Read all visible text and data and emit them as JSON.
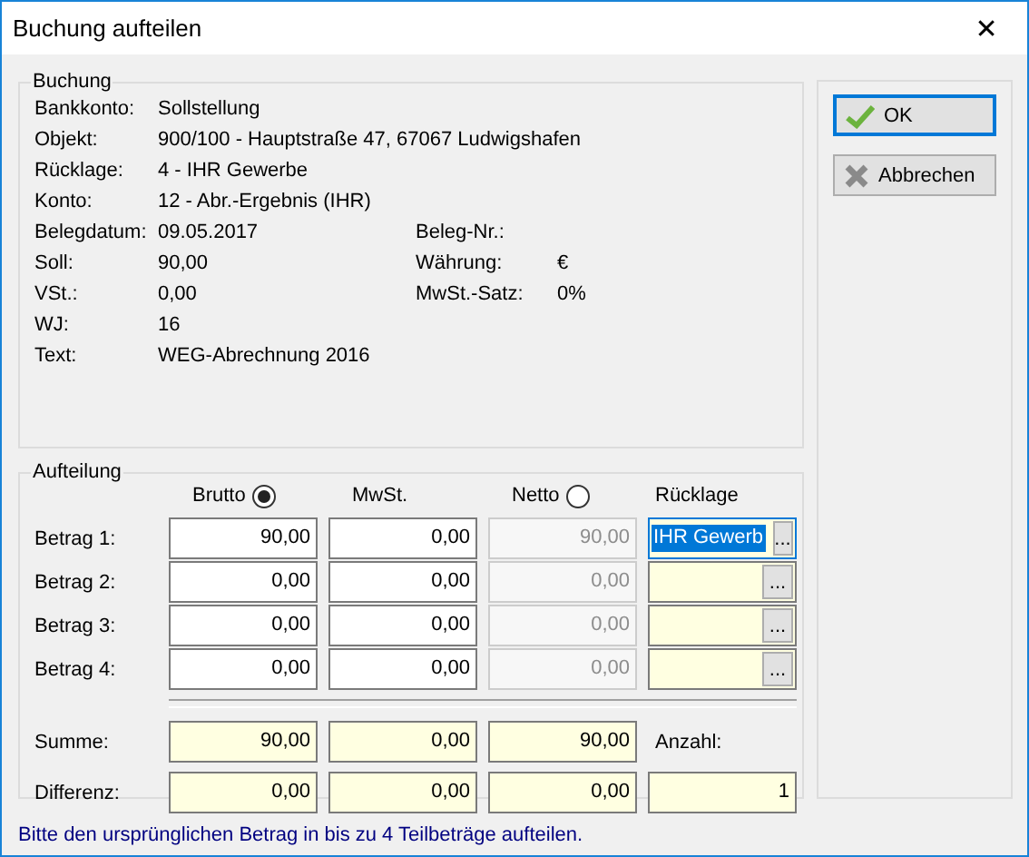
{
  "window": {
    "title": "Buchung aufteilen",
    "close": "✕"
  },
  "booking": {
    "title": "Buchung",
    "rows": [
      {
        "label": "Bankkonto:",
        "value": "Sollstellung"
      },
      {
        "label": "Objekt:",
        "value": "900/100 - Hauptstraße 47, 67067 Ludwigshafen"
      },
      {
        "label": "Rücklage:",
        "value": "4 - IHR Gewerbe"
      },
      {
        "label": "Konto:",
        "value": "12 - Abr.-Ergebnis (IHR)"
      },
      {
        "label": "Belegdatum:",
        "value": "09.05.2017",
        "label2": "Beleg-Nr.:"
      },
      {
        "label": "Soll:",
        "value": "90,00",
        "label2": "Währung:",
        "value2": "€"
      },
      {
        "label": "VSt.:",
        "value": "0,00",
        "label2": "MwSt.-Satz:",
        "value2": "0%"
      },
      {
        "label": "WJ:",
        "value": "16"
      },
      {
        "label": "Text:",
        "value": "WEG-Abrechnung 2016"
      }
    ]
  },
  "split": {
    "title": "Aufteilung",
    "columns": [
      {
        "label": "Brutto",
        "kind": "radio",
        "selected": true,
        "disabled": false
      },
      {
        "label": "MwSt.",
        "kind": "plain",
        "disabled": false
      },
      {
        "label": "Netto",
        "kind": "radio",
        "selected": false,
        "disabled": true
      },
      {
        "label": "Rücklage",
        "kind": "plain",
        "disabled": false
      }
    ],
    "rows": [
      {
        "label": "Betrag 1:",
        "values": [
          "90,00",
          "0,00",
          "90,00"
        ],
        "reserve": {
          "value": "IHR Gewerb",
          "focused": true,
          "button": "..."
        }
      },
      {
        "label": "Betrag 2:",
        "values": [
          "0,00",
          "0,00",
          "0,00"
        ],
        "reserve": {
          "focused": false,
          "button": "..."
        }
      },
      {
        "label": "Betrag 3:",
        "values": [
          "0,00",
          "0,00",
          "0,00"
        ],
        "reserve": {
          "focused": false,
          "button": "..."
        }
      },
      {
        "label": "Betrag 4:",
        "values": [
          "0,00",
          "0,00",
          "0,00"
        ],
        "reserve": {
          "focused": false,
          "button": "..."
        }
      }
    ],
    "totals": [
      {
        "label": "Summe:",
        "values": [
          "90,00",
          "0,00",
          "90,00"
        ],
        "extra_label": "Anzahl:"
      },
      {
        "label": "Differenz:",
        "values": [
          "0,00",
          "0,00",
          "0,00"
        ],
        "extra_value": "1"
      }
    ]
  },
  "buttons": [
    {
      "label": "OK",
      "kind": "ok",
      "default": true
    },
    {
      "label": "Abbrechen",
      "kind": "cancel",
      "default": false
    }
  ],
  "status": "Bitte den ursprünglichen Betrag in bis zu 4 Teilbeträge aufteilen."
}
